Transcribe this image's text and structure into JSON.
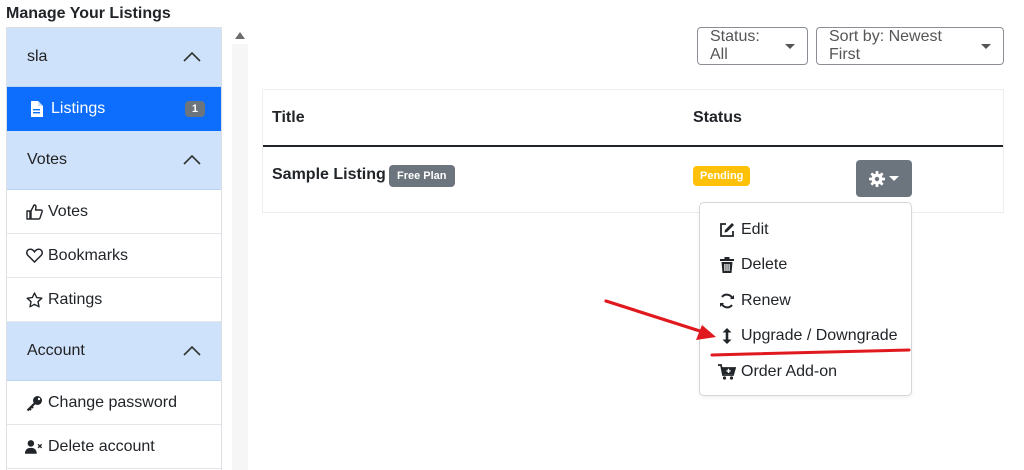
{
  "page": {
    "title": "Manage Your Listings"
  },
  "sidebar": {
    "groups": [
      {
        "label": "sla",
        "items": [
          {
            "label": "Listings",
            "icon": "file-icon",
            "count": "1",
            "active": true
          }
        ]
      },
      {
        "label": "Votes",
        "items": [
          {
            "label": "Votes",
            "icon": "thumbs-up-icon"
          },
          {
            "label": "Bookmarks",
            "icon": "heart-icon"
          },
          {
            "label": "Ratings",
            "icon": "star-icon"
          }
        ]
      },
      {
        "label": "Account",
        "items": [
          {
            "label": "Change password",
            "icon": "key-icon"
          },
          {
            "label": "Delete account",
            "icon": "user-remove-icon"
          }
        ]
      }
    ]
  },
  "filters": {
    "status": "Status: All",
    "sort": "Sort by: Newest First"
  },
  "table": {
    "columns": [
      "Title",
      "Status"
    ],
    "rows": [
      {
        "title": "Sample Listing",
        "plan": "Free Plan",
        "status": "Pending"
      }
    ]
  },
  "actions_menu": {
    "items": [
      {
        "label": "Edit",
        "icon": "edit-icon"
      },
      {
        "label": "Delete",
        "icon": "trash-icon"
      },
      {
        "label": "Renew",
        "icon": "refresh-icon"
      },
      {
        "label": "Upgrade / Downgrade",
        "icon": "up-down-arrows-icon"
      },
      {
        "label": "Order Add-on",
        "icon": "cart-plus-icon"
      }
    ]
  },
  "colors": {
    "accent": "#0d6efd",
    "group_bg": "#cfe2fb",
    "badge_gray": "#6c757d",
    "pending": "#ffc107",
    "annotation_red": "#e0191f"
  }
}
